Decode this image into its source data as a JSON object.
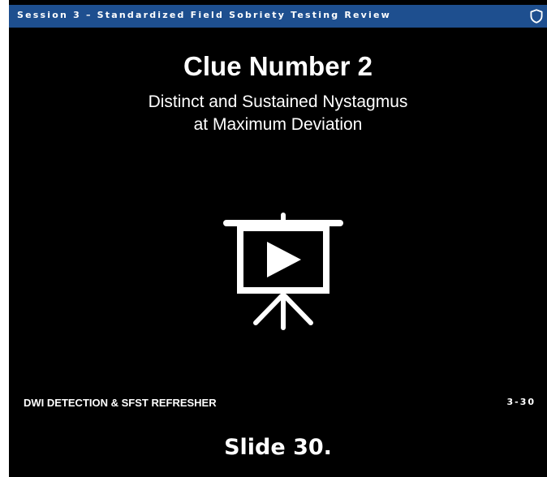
{
  "header": {
    "session_title": "Session 3 – Standardized Field Sobriety Testing Review",
    "icon": "shield-icon"
  },
  "slide": {
    "title": "Clue Number 2",
    "subtitle_line1": "Distinct and Sustained Nystagmus",
    "subtitle_line2": "at Maximum Deviation",
    "media_icon": "video-presentation-icon"
  },
  "footer": {
    "course": "DWI DETECTION & SFST REFRESHER",
    "slide_number": "3-30"
  },
  "caption": "Slide 30.",
  "colors": {
    "background": "#000000",
    "header_bar": "#1e4f8f",
    "text": "#ffffff"
  }
}
